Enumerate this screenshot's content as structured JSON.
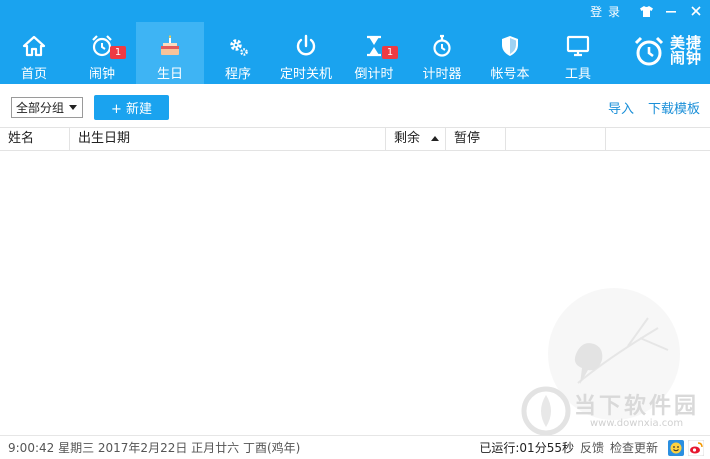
{
  "window": {
    "login_label": "登 录",
    "skin_icon": "shirt-icon",
    "minimize_icon": "minimize-icon",
    "close_icon": "close-icon"
  },
  "nav": [
    {
      "label": "首页",
      "icon": "home-icon",
      "active": false
    },
    {
      "label": "闹钟",
      "icon": "alarm-clock-icon",
      "active": false,
      "badge": "1"
    },
    {
      "label": "生日",
      "icon": "birthday-cake-icon",
      "active": true
    },
    {
      "label": "程序",
      "icon": "gear-icon",
      "active": false
    },
    {
      "label": "定时关机",
      "icon": "power-icon",
      "active": false
    },
    {
      "label": "倒计时",
      "icon": "hourglass-icon",
      "active": false,
      "badge": "1"
    },
    {
      "label": "计时器",
      "icon": "stopwatch-icon",
      "active": false
    },
    {
      "label": "帐号本",
      "icon": "shield-icon",
      "active": false
    },
    {
      "label": "工具",
      "icon": "monitor-icon",
      "active": false
    }
  ],
  "brand": {
    "name": "美捷闹钟",
    "icon": "alarm-clock-logo-icon"
  },
  "toolbar": {
    "group_select": "全部分组",
    "new_button": "+ 新建",
    "import_link": "导入",
    "template_link": "下载模板"
  },
  "table": {
    "columns": [
      "姓名",
      "出生日期",
      "剩余",
      "暂停",
      "",
      ""
    ],
    "sorted_column": "剩余",
    "rows": []
  },
  "watermark": {
    "text": "当下软件园",
    "url": "www.downxia.com"
  },
  "status": {
    "datetime": "9:00:42 星期三 2017年2月22日 正月廿六 丁酉(鸡年)",
    "runtime": "已运行:01分55秒",
    "feedback": "反馈",
    "update": "检查更新",
    "smiley_icon": "smiley-icon",
    "weibo_icon": "weibo-icon"
  },
  "colors": {
    "accent": "#1aa3ef",
    "link": "#1a8fd8",
    "badge": "#ee3a43"
  }
}
